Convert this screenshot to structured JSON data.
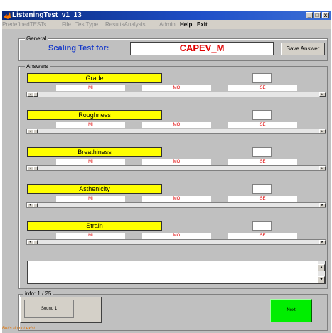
{
  "window": {
    "title": "ListeningTest_v1_13",
    "controls": {
      "minimize": "_",
      "maximize": "□",
      "close": "x"
    }
  },
  "menu": [
    {
      "label": "PredefinedTESTs",
      "enabled": false
    },
    {
      "label": "File",
      "enabled": false
    },
    {
      "label": "TestType",
      "enabled": false
    },
    {
      "label": "ResultsAnalysis",
      "enabled": false
    },
    {
      "label": "Admin",
      "enabled": false
    },
    {
      "label": "Help",
      "enabled": true
    },
    {
      "label": "Exit",
      "enabled": true
    }
  ],
  "general": {
    "panel_title": "General",
    "scaling_label": "Scaling Test for:",
    "scale_name": "CAPEV_M",
    "save_button": "Save Answer"
  },
  "answers": {
    "panel_title": "Answers",
    "scale_points": [
      "MI",
      "MO",
      "SE"
    ],
    "attributes": [
      {
        "name": "Grade",
        "value": ""
      },
      {
        "name": "Roughness",
        "value": ""
      },
      {
        "name": "Breathiness",
        "value": ""
      },
      {
        "name": "Asthenicity",
        "value": ""
      },
      {
        "name": "Strain",
        "value": ""
      }
    ],
    "slider_arrows": {
      "left": "◂",
      "right": "▸"
    },
    "comment_text": "",
    "scroll_arrows": {
      "up": "▲",
      "down": "▼"
    }
  },
  "info": {
    "label": "info: 1 / 25",
    "sound_button": "Sound 1",
    "next_button": "Next"
  },
  "status": "Butts do not exist",
  "colors": {
    "attribute_bg": "#ffff00",
    "scale_text": "#e00000",
    "scaling_label": "#1a3cc8",
    "next_button": "#00ee00",
    "status": "#e07000"
  }
}
